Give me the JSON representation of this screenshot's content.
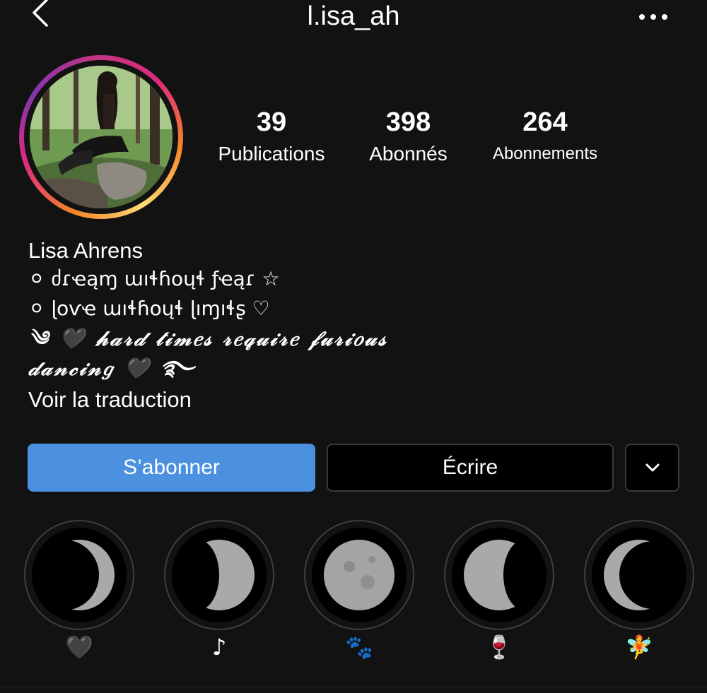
{
  "header": {
    "username": "l.isa_ah",
    "back_icon": "chevron-left-icon",
    "more_icon": "more-horizontal-icon"
  },
  "profile": {
    "avatar_ring_colors": [
      "#f58529",
      "#dd2a7b",
      "#8134af"
    ]
  },
  "stats": {
    "posts": {
      "count": "39",
      "label": "Publications"
    },
    "followers": {
      "count": "398",
      "label": "Abonnés"
    },
    "following": {
      "count": "264",
      "label": "Abonnements"
    }
  },
  "bio": {
    "name": "Lisa Ahrens",
    "line1": "⚪ ძɾҽąɱ ɯıɬɦօųɬ ƒҽąɾ ☆",
    "line2": "⚪ ɭօѵҽ ɯıɬɦօųɬ ɭıɱıɬʂ ♡",
    "line3": "༄ 🖤 𝒽𝒶𝓇𝒹 𝓉𝒾𝓂𝑒𝓈 𝓇𝑒𝓆𝓊𝒾𝓇𝑒 𝒻𝓊𝓇𝒾𝑜𝓊𝓈",
    "line4": "𝒹𝒶𝓃𝒸𝒾𝓃𝑔 🖤 ࿐",
    "translate_link": "Voir la traduction"
  },
  "actions": {
    "follow_label": "S’abonner",
    "message_label": "Écrire",
    "dropdown_icon": "chevron-down-icon",
    "follow_color": "#4c91e0"
  },
  "highlights": [
    {
      "emoji": "🖤",
      "moon": "waning-crescent"
    },
    {
      "emoji": "♪",
      "moon": "waxing-gibbous-left"
    },
    {
      "emoji": "🐾",
      "moon": "full-moon"
    },
    {
      "emoji": "🍷",
      "moon": "waning-gibbous"
    },
    {
      "emoji": "🧚",
      "moon": "crescent"
    }
  ]
}
